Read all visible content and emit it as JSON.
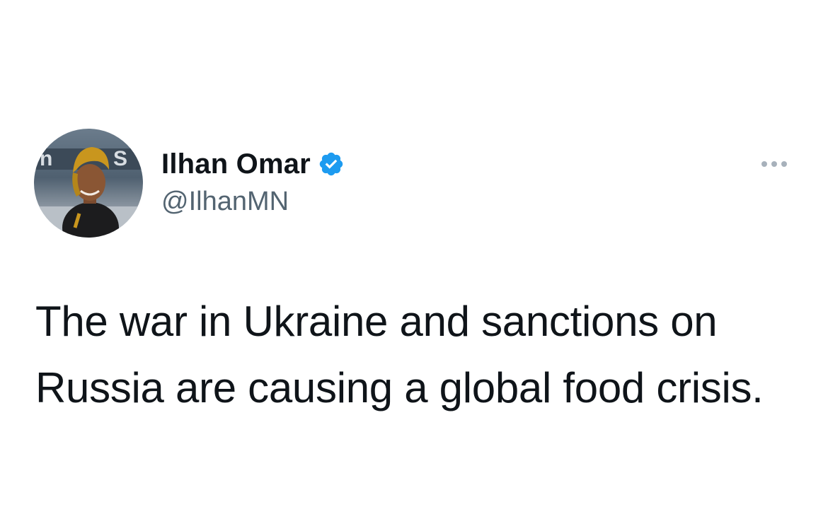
{
  "tweet": {
    "author": {
      "display_name": "Ilhan Omar",
      "handle": "@IlhanMN",
      "verified": true,
      "avatar_icon": "profile-photo"
    },
    "more_icon": "more-options-icon",
    "text_lines": [
      "The war in Ukraine and sanctions on",
      "Russia are causing a global food crisis."
    ]
  },
  "colors": {
    "text_primary": "#0f1419",
    "text_secondary": "#536471",
    "verified_blue": "#1d9bf0",
    "background": "#ffffff"
  }
}
